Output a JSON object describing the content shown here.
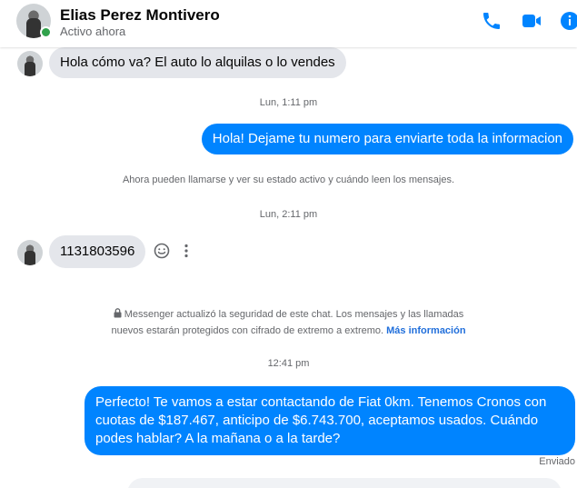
{
  "header": {
    "name": "Elias Perez Montivero",
    "status": "Activo ahora"
  },
  "icons": {
    "phone": "phone-icon",
    "video": "video-camera-icon",
    "info": "info-icon",
    "react": "smiley-icon",
    "more": "more-vertical-icon",
    "lock": "lock-icon"
  },
  "colors": {
    "accent": "#0084ff",
    "online": "#31a24c",
    "incoming_bubble": "#e4e6eb",
    "link": "#216fdb"
  },
  "messages": [
    {
      "dir": "in",
      "text": "Hola cómo va? El auto lo alquilas o lo vendes"
    },
    {
      "dir": "ts",
      "text": "Lun, 1:11 pm"
    },
    {
      "dir": "out",
      "text": "Hola! Dejame tu numero para enviarte toda la informacion"
    },
    {
      "dir": "sys",
      "text": "Ahora pueden llamarse y ver su estado activo y cuándo leen los mensajes."
    },
    {
      "dir": "ts",
      "text": "Lun, 2:11 pm"
    },
    {
      "dir": "in",
      "text": "1131803596"
    },
    {
      "dir": "sys",
      "line1": "Messenger actualizó la seguridad de este chat. Los mensajes y las llamadas",
      "line2": "nuevos estarán protegidos con cifrado de extremo a extremo.",
      "link": "Más información"
    },
    {
      "dir": "ts",
      "text": "12:41 pm"
    },
    {
      "dir": "out",
      "text": "Perfecto! Te vamos a estar contactando de Fiat 0km. Tenemos Cronos con cuotas de $187.467, anticipo de $6.743.700, aceptamos usados. Cuándo podes hablar? A la mañana o a la tarde?"
    }
  ],
  "receipt": "Enviado"
}
